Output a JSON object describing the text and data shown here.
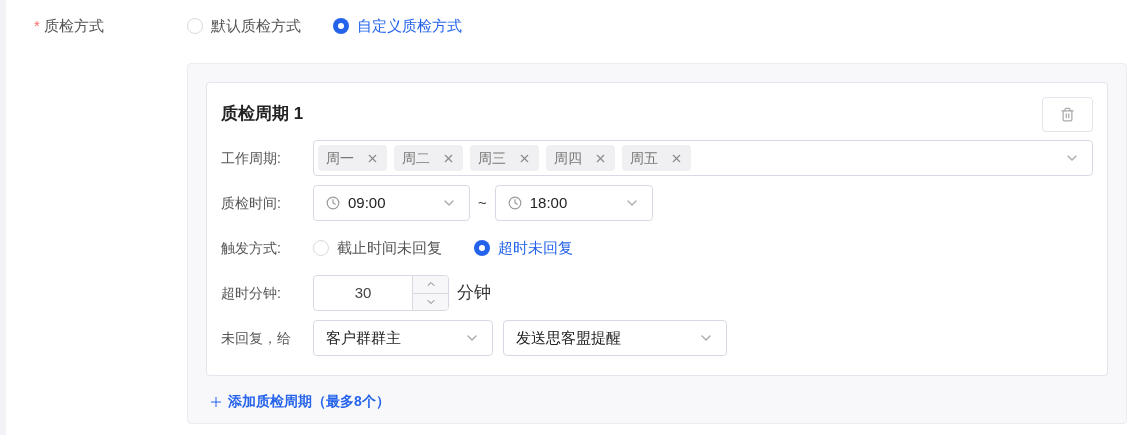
{
  "field": {
    "label": "质检方式",
    "required_mark": "*"
  },
  "mode_options": [
    {
      "label": "默认质检方式",
      "selected": false
    },
    {
      "label": "自定义质检方式",
      "selected": true
    }
  ],
  "periods": [
    {
      "title": "质检周期 1",
      "workdays": {
        "label": "工作周期:",
        "tags": [
          "周一",
          "周二",
          "周三",
          "周四",
          "周五"
        ]
      },
      "time": {
        "label": "质检时间:",
        "start": "09:00",
        "separator": "~",
        "end": "18:00"
      },
      "trigger": {
        "label": "触发方式:",
        "options": [
          {
            "label": "截止时间未回复",
            "selected": false
          },
          {
            "label": "超时未回复",
            "selected": true
          }
        ]
      },
      "timeout": {
        "label": "超时分钟:",
        "value": "30",
        "unit": "分钟"
      },
      "notify": {
        "label": "未回复，给",
        "target": "客户群群主",
        "action": "发送思客盟提醒"
      }
    }
  ],
  "add_link": "添加质检周期（最多8个）"
}
